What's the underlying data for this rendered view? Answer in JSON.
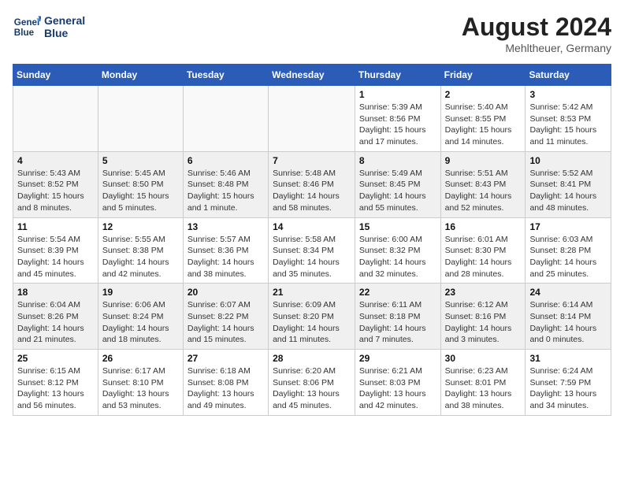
{
  "header": {
    "logo_line1": "General",
    "logo_line2": "Blue",
    "month_year": "August 2024",
    "location": "Mehltheuer, Germany"
  },
  "days_of_week": [
    "Sunday",
    "Monday",
    "Tuesday",
    "Wednesday",
    "Thursday",
    "Friday",
    "Saturday"
  ],
  "weeks": [
    [
      {
        "day": "",
        "empty": true
      },
      {
        "day": "",
        "empty": true
      },
      {
        "day": "",
        "empty": true
      },
      {
        "day": "",
        "empty": true
      },
      {
        "day": "1",
        "sunrise": "5:39 AM",
        "sunset": "8:56 PM",
        "daylight": "15 hours and 17 minutes."
      },
      {
        "day": "2",
        "sunrise": "5:40 AM",
        "sunset": "8:55 PM",
        "daylight": "15 hours and 14 minutes."
      },
      {
        "day": "3",
        "sunrise": "5:42 AM",
        "sunset": "8:53 PM",
        "daylight": "15 hours and 11 minutes."
      }
    ],
    [
      {
        "day": "4",
        "sunrise": "5:43 AM",
        "sunset": "8:52 PM",
        "daylight": "15 hours and 8 minutes."
      },
      {
        "day": "5",
        "sunrise": "5:45 AM",
        "sunset": "8:50 PM",
        "daylight": "15 hours and 5 minutes."
      },
      {
        "day": "6",
        "sunrise": "5:46 AM",
        "sunset": "8:48 PM",
        "daylight": "15 hours and 1 minute."
      },
      {
        "day": "7",
        "sunrise": "5:48 AM",
        "sunset": "8:46 PM",
        "daylight": "14 hours and 58 minutes."
      },
      {
        "day": "8",
        "sunrise": "5:49 AM",
        "sunset": "8:45 PM",
        "daylight": "14 hours and 55 minutes."
      },
      {
        "day": "9",
        "sunrise": "5:51 AM",
        "sunset": "8:43 PM",
        "daylight": "14 hours and 52 minutes."
      },
      {
        "day": "10",
        "sunrise": "5:52 AM",
        "sunset": "8:41 PM",
        "daylight": "14 hours and 48 minutes."
      }
    ],
    [
      {
        "day": "11",
        "sunrise": "5:54 AM",
        "sunset": "8:39 PM",
        "daylight": "14 hours and 45 minutes."
      },
      {
        "day": "12",
        "sunrise": "5:55 AM",
        "sunset": "8:38 PM",
        "daylight": "14 hours and 42 minutes."
      },
      {
        "day": "13",
        "sunrise": "5:57 AM",
        "sunset": "8:36 PM",
        "daylight": "14 hours and 38 minutes."
      },
      {
        "day": "14",
        "sunrise": "5:58 AM",
        "sunset": "8:34 PM",
        "daylight": "14 hours and 35 minutes."
      },
      {
        "day": "15",
        "sunrise": "6:00 AM",
        "sunset": "8:32 PM",
        "daylight": "14 hours and 32 minutes."
      },
      {
        "day": "16",
        "sunrise": "6:01 AM",
        "sunset": "8:30 PM",
        "daylight": "14 hours and 28 minutes."
      },
      {
        "day": "17",
        "sunrise": "6:03 AM",
        "sunset": "8:28 PM",
        "daylight": "14 hours and 25 minutes."
      }
    ],
    [
      {
        "day": "18",
        "sunrise": "6:04 AM",
        "sunset": "8:26 PM",
        "daylight": "14 hours and 21 minutes."
      },
      {
        "day": "19",
        "sunrise": "6:06 AM",
        "sunset": "8:24 PM",
        "daylight": "14 hours and 18 minutes."
      },
      {
        "day": "20",
        "sunrise": "6:07 AM",
        "sunset": "8:22 PM",
        "daylight": "14 hours and 15 minutes."
      },
      {
        "day": "21",
        "sunrise": "6:09 AM",
        "sunset": "8:20 PM",
        "daylight": "14 hours and 11 minutes."
      },
      {
        "day": "22",
        "sunrise": "6:11 AM",
        "sunset": "8:18 PM",
        "daylight": "14 hours and 7 minutes."
      },
      {
        "day": "23",
        "sunrise": "6:12 AM",
        "sunset": "8:16 PM",
        "daylight": "14 hours and 3 minutes."
      },
      {
        "day": "24",
        "sunrise": "6:14 AM",
        "sunset": "8:14 PM",
        "daylight": "14 hours and 0 minutes."
      }
    ],
    [
      {
        "day": "25",
        "sunrise": "6:15 AM",
        "sunset": "8:12 PM",
        "daylight": "13 hours and 56 minutes."
      },
      {
        "day": "26",
        "sunrise": "6:17 AM",
        "sunset": "8:10 PM",
        "daylight": "13 hours and 53 minutes."
      },
      {
        "day": "27",
        "sunrise": "6:18 AM",
        "sunset": "8:08 PM",
        "daylight": "13 hours and 49 minutes."
      },
      {
        "day": "28",
        "sunrise": "6:20 AM",
        "sunset": "8:06 PM",
        "daylight": "13 hours and 45 minutes."
      },
      {
        "day": "29",
        "sunrise": "6:21 AM",
        "sunset": "8:03 PM",
        "daylight": "13 hours and 42 minutes."
      },
      {
        "day": "30",
        "sunrise": "6:23 AM",
        "sunset": "8:01 PM",
        "daylight": "13 hours and 38 minutes."
      },
      {
        "day": "31",
        "sunrise": "6:24 AM",
        "sunset": "7:59 PM",
        "daylight": "13 hours and 34 minutes."
      }
    ]
  ]
}
